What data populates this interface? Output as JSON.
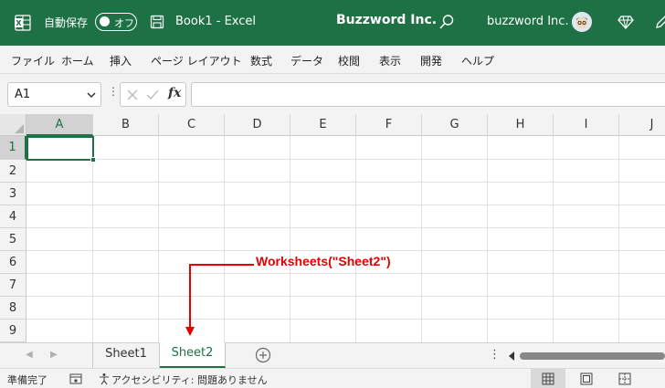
{
  "titlebar": {
    "autosave_label": "自動保存",
    "autosave_state": "オフ",
    "doc_title": "Book1  -  Excel",
    "company": "Buzzword Inc.",
    "user": "buzzword Inc.",
    "accent": "#1e7145"
  },
  "menu": {
    "items": [
      "ファイル",
      "ホーム",
      "挿入",
      "ページ レイアウト",
      "数式",
      "データ",
      "校閲",
      "表示",
      "開発",
      "ヘルプ"
    ]
  },
  "formula": {
    "namebox": "A1",
    "value": ""
  },
  "grid": {
    "columns": [
      "A",
      "B",
      "C",
      "D",
      "E",
      "F",
      "G",
      "H",
      "I",
      "J"
    ],
    "rows": [
      "1",
      "2",
      "3",
      "4",
      "5",
      "6",
      "7",
      "8",
      "9"
    ],
    "active_column": "A",
    "active_row": "1"
  },
  "annotation": {
    "text": "Worksheets(\"Sheet2\")",
    "color": "#e60000"
  },
  "sheets": {
    "tabs": [
      "Sheet1",
      "Sheet2"
    ],
    "active": "Sheet2"
  },
  "status": {
    "ready": "準備完了",
    "accessibility": "アクセシビリティ: 問題ありません"
  },
  "icons": [
    "excel-logo-icon",
    "save-icon",
    "search-icon",
    "avatar-icon",
    "diamond-icon",
    "pen-icon",
    "chevron-down-icon",
    "cancel-icon",
    "check-icon",
    "function-icon",
    "add-sheet-icon",
    "macro-record-icon",
    "accessibility-icon",
    "normal-view-icon",
    "page-layout-view-icon",
    "page-break-view-icon"
  ]
}
